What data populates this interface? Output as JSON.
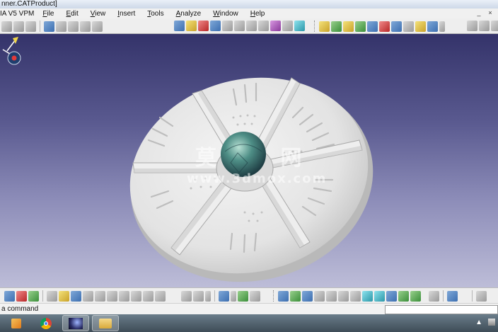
{
  "window": {
    "title": "nner.CATProduct]"
  },
  "menu": {
    "app_label": "IA V5 VPM",
    "items": [
      "File",
      "Edit",
      "View",
      "Insert",
      "Tools",
      "Analyze",
      "Window",
      "Help"
    ],
    "caption_min": "_",
    "caption_close": "×"
  },
  "viewport": {
    "watermark_cn": "莫 网",
    "watermark_url": "www.3dmox.com",
    "background_top": "#34336a",
    "background_bottom": "#bdbdd8",
    "part_color": "#ececec",
    "hub_color": "#3d7a78"
  },
  "status": {
    "prompt": "a command",
    "command_value": ""
  },
  "taskbar": {
    "items": [
      "media-player-icon",
      "chrome-icon",
      "space-image-icon",
      "folder-icon"
    ],
    "tray_arrow": "▲"
  }
}
